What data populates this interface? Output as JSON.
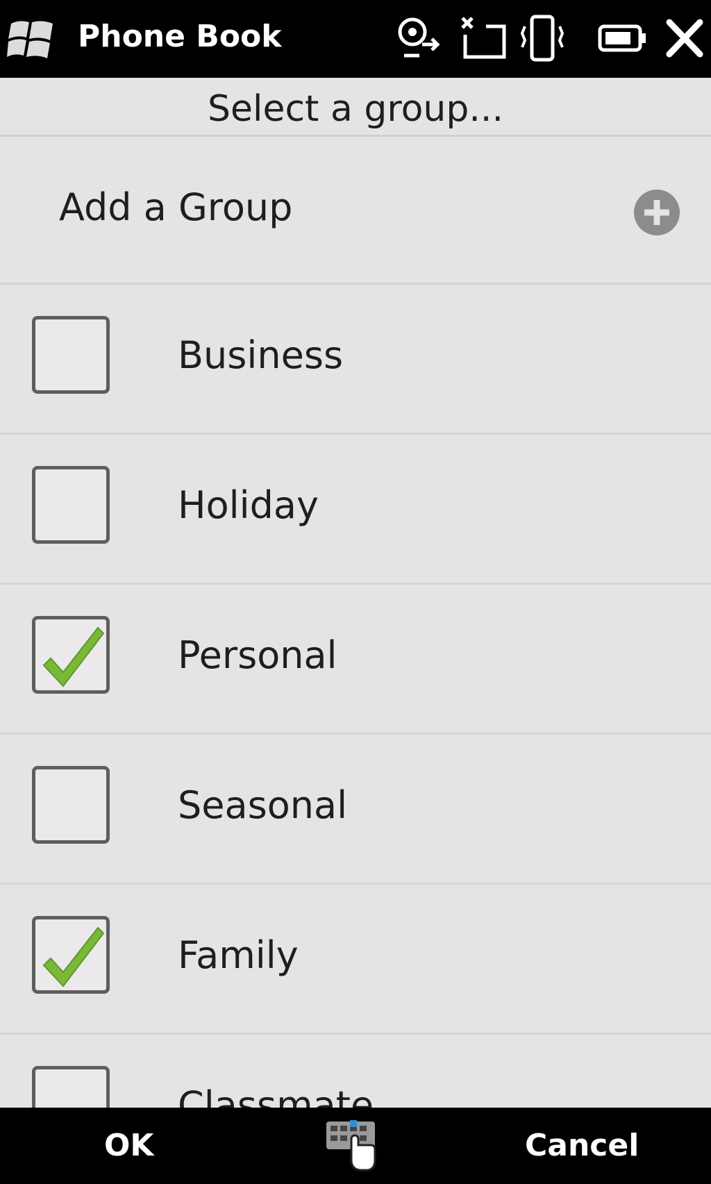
{
  "titlebar": {
    "title": "Phone Book",
    "icons": [
      "windows-start-icon",
      "connectivity-icon",
      "no-signal-icon",
      "vibrate-icon",
      "battery-icon",
      "close-icon"
    ]
  },
  "dialog": {
    "heading": "Select a group...",
    "add_group_label": "Add a Group",
    "add_group_icon": "plus-circle-icon"
  },
  "groups": [
    {
      "label": "Business",
      "checked": false
    },
    {
      "label": "Holiday",
      "checked": false
    },
    {
      "label": "Personal",
      "checked": true
    },
    {
      "label": "Seasonal",
      "checked": false
    },
    {
      "label": "Family",
      "checked": true
    },
    {
      "label": "Classmate",
      "checked": false
    }
  ],
  "softkeys": {
    "left": "OK",
    "center_icon": "keyboard-icon",
    "right": "Cancel"
  },
  "colors": {
    "bar_bg": "#000000",
    "content_bg": "#e4e4e4",
    "check_green": "#7ab83a",
    "plus_gray": "#8c8c8c"
  }
}
